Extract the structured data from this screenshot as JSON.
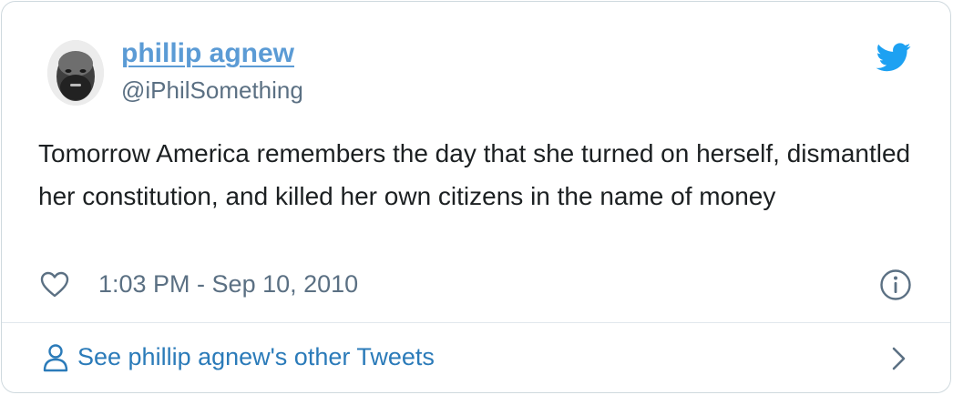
{
  "author": {
    "name": "phillip agnew",
    "handle": "@iPhilSomething"
  },
  "tweet": {
    "text": "Tomorrow America remembers the day that she turned on herself, dismantled her constitution, and killed her own citizens in the name of money",
    "timestamp": "1:03 PM - Sep 10, 2010"
  },
  "footer": {
    "link_text": "See phillip agnew's other Tweets"
  },
  "icons": {
    "brand": "twitter-bird-icon",
    "like": "heart-icon",
    "info": "info-icon",
    "person": "person-icon",
    "chevron": "chevron-right-icon"
  },
  "colors": {
    "link": "#5b9bd5",
    "footer_link": "#2b7bb9",
    "twitter_blue": "#1da1f2",
    "muted": "#5b7083",
    "text": "#1c2022",
    "border": "#cfd9de"
  }
}
